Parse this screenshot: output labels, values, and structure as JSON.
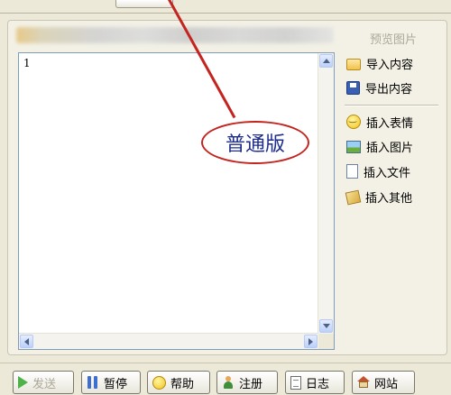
{
  "annotation": {
    "label": "普通版",
    "color": "#C4241F",
    "text_color": "#1E2C8C"
  },
  "editor": {
    "content_line": "1"
  },
  "side_panel": {
    "preview_label": "预览图片",
    "import_label": "导入内容",
    "export_label": "导出内容",
    "insert_emoji_label": "插入表情",
    "insert_image_label": "插入图片",
    "insert_file_label": "插入文件",
    "insert_other_label": "插入其他",
    "icons": [
      "folder-icon",
      "save-icon",
      "smiley-icon",
      "picture-icon",
      "file-icon",
      "other-icon"
    ]
  },
  "toolbar": {
    "send_label": "发送",
    "pause_label": "暂停",
    "help_label": "帮助",
    "register_label": "注册",
    "log_label": "日志",
    "website_label": "网站"
  },
  "colors": {
    "window_bg": "#ECE9D8",
    "editor_border": "#7F9DB9",
    "disabled_text": "#ACA899"
  }
}
